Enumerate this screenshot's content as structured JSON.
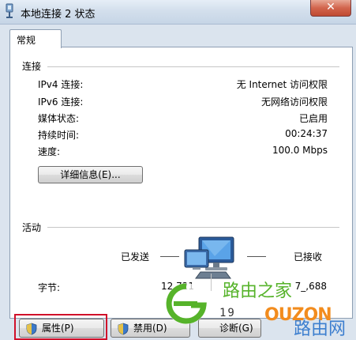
{
  "window": {
    "title": "本地连接 2 状态",
    "close_label": "✕"
  },
  "tabs": [
    {
      "label": "常规"
    }
  ],
  "connection": {
    "section_title": "连接",
    "rows": [
      {
        "label": "IPv4 连接:",
        "value": "无 Internet 访问权限"
      },
      {
        "label": "IPv6 连接:",
        "value": "无网络访问权限"
      },
      {
        "label": "媒体状态:",
        "value": "已启用"
      },
      {
        "label": "持续时间:",
        "value": "00:24:37"
      },
      {
        "label": "速度:",
        "value": "100.0 Mbps"
      }
    ],
    "details_button": "详细信息(E)..."
  },
  "activity": {
    "section_title": "活动",
    "sent_label": "已发送",
    "received_label": "已接收",
    "bytes_label": "字节:",
    "bytes_sent": "12,721",
    "bytes_received": "7_,688"
  },
  "buttons": {
    "properties": "属性(P)",
    "disable": "禁用(D)",
    "diagnose": "诊断(G)"
  },
  "watermark": {
    "brand_cn": "路由之家",
    "brand_cn2": "路由网",
    "site_digits": "19",
    "site_latin": "OUZON"
  },
  "colors": {
    "highlight_border": "#d0102a",
    "title_bar": "#d3dfec",
    "watermark_green": "#56b32a",
    "watermark_blue": "#3d7fcf"
  }
}
